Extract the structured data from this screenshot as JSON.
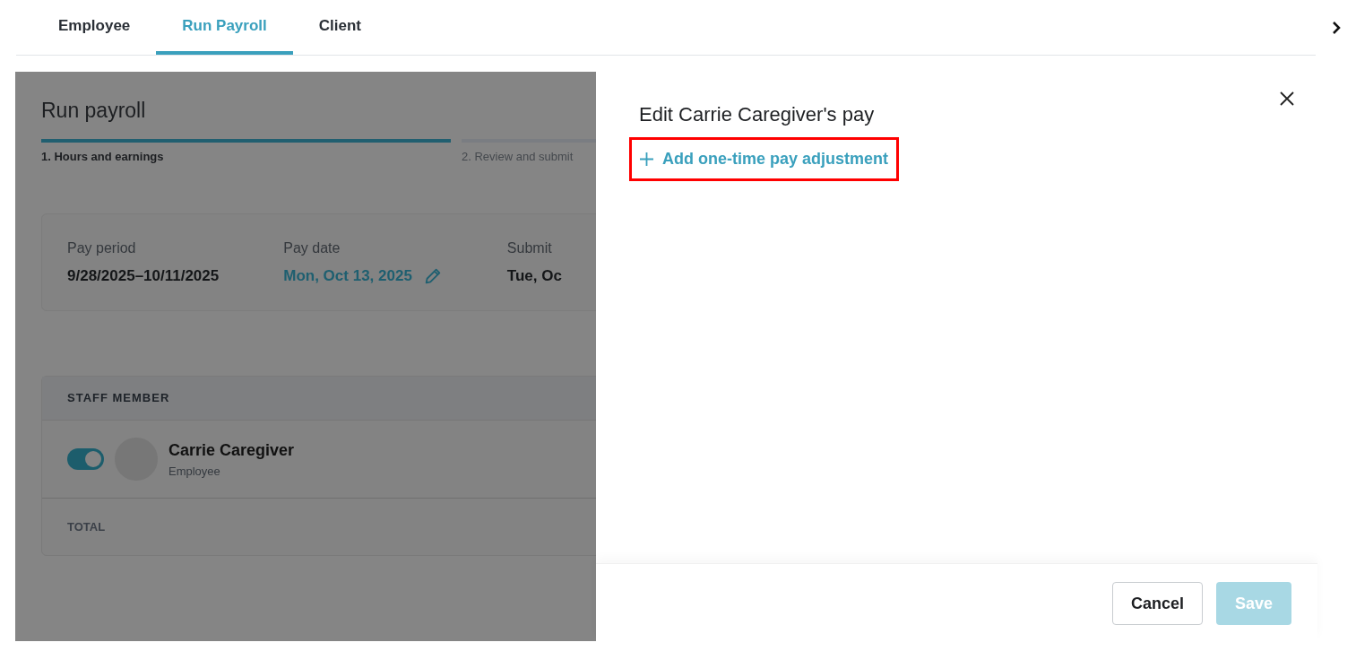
{
  "tabs": [
    {
      "label": "Employee",
      "selected": false
    },
    {
      "label": "Run Payroll",
      "selected": true
    },
    {
      "label": "Client",
      "selected": false
    }
  ],
  "page": {
    "title": "Run payroll",
    "steps": [
      {
        "label": "1. Hours and earnings",
        "selected": true
      },
      {
        "label": "2. Review and submit",
        "selected": false
      }
    ],
    "summary": [
      {
        "label": "Pay period",
        "value": "9/28/2025–10/11/2025",
        "kind": "text"
      },
      {
        "label": "Pay date",
        "value": "Mon, Oct 13, 2025",
        "kind": "editable"
      },
      {
        "label": "Submit",
        "value": "Tue, Oc",
        "kind": "text"
      }
    ],
    "table": {
      "header": "STAFF MEMBER",
      "rows": [
        {
          "name": "Carrie Caregiver",
          "role": "Employee",
          "on": true
        }
      ],
      "total": "TOTAL"
    }
  },
  "drawer": {
    "title": "Edit Carrie Caregiver's pay",
    "add_link": {
      "label": "Add one-time pay adjustment",
      "highlighted": true
    },
    "buttons": [
      {
        "label": "Cancel",
        "kind": "secondary",
        "disabled": false
      },
      {
        "label": "Save",
        "kind": "primary",
        "disabled": true
      }
    ]
  }
}
